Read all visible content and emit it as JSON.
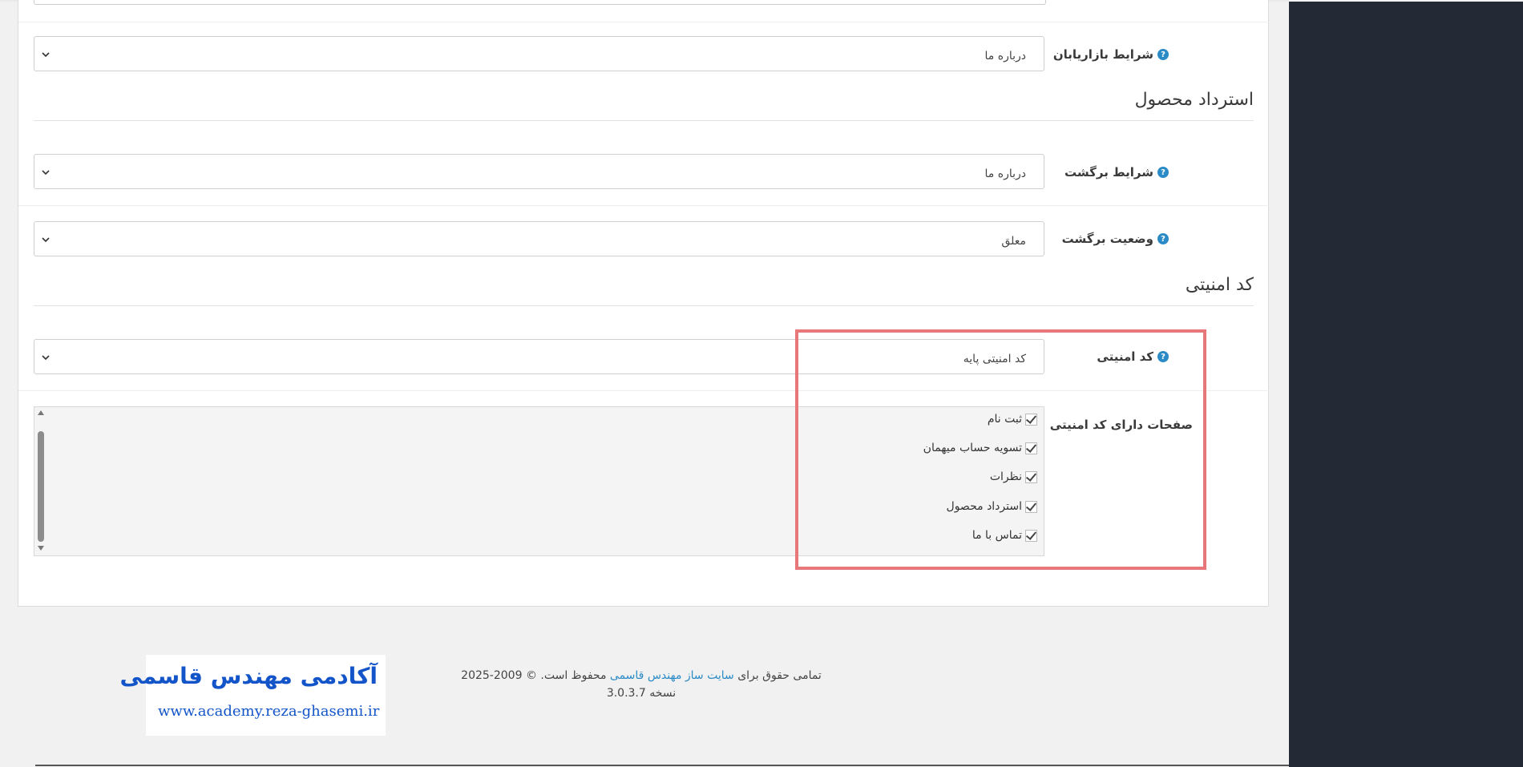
{
  "form": {
    "marketer_terms": {
      "label": "شرایط بازاریابان",
      "help": "?",
      "value": "درباره ما"
    },
    "returns_section_title": "استرداد محصول",
    "return_terms": {
      "label": "شرایط برگشت",
      "help": "?",
      "value": "درباره ما"
    },
    "return_status": {
      "label": "وضعیت برگشت",
      "help": "?",
      "value": "معلق"
    },
    "security_section_title": "کد امنیتی",
    "captcha": {
      "label": "کد امنیتی",
      "help": "?",
      "value": "کد امنیتی پایه"
    },
    "captcha_pages": {
      "label": "صفحات دارای کد امنیتی",
      "items": [
        {
          "label": "ثبت نام",
          "checked": true
        },
        {
          "label": "تسویه حساب میهمان",
          "checked": true
        },
        {
          "label": "نظرات",
          "checked": true
        },
        {
          "label": "استرداد محصول",
          "checked": true
        },
        {
          "label": "تماس با ما",
          "checked": true
        }
      ]
    }
  },
  "footer": {
    "rights_prefix": "تمامی حقوق برای",
    "site_link": "سایت ساز مهندس قاسمی",
    "rights_suffix": "محفوظ است. © 2009-2025",
    "version": "نسخه 3.0.3.7"
  },
  "logo": {
    "title": "آکادمی مهندس قاسمی",
    "url": "www.academy.reza-ghasemi.ir"
  },
  "colors": {
    "sidebar": "#242a35",
    "highlight": "#e8777a",
    "link": "#2b8bc6",
    "logo": "#1355c8"
  }
}
